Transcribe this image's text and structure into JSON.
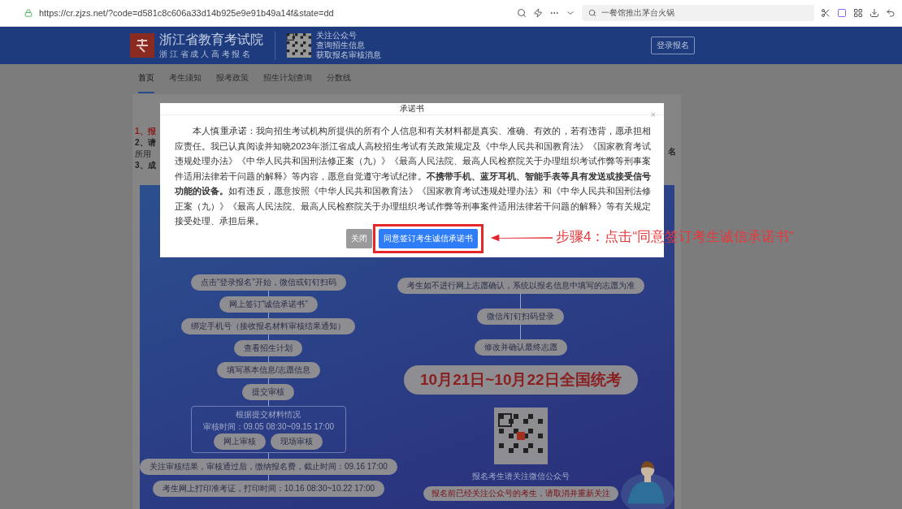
{
  "browser": {
    "url": "https://cr.zjzs.net/?code=d581c8c606a33d14b925e9e91b49a14f&state=dd",
    "search": "一餐馆推出茅台火锅"
  },
  "header": {
    "site_name": "浙江省教育考试院",
    "site_subtitle": "浙 江 省 成 人 高 考 报 名",
    "follow_lines": [
      "关注公众号",
      "查询招生信息",
      "获取报名审核消息"
    ],
    "login_button": "登录报名"
  },
  "nav": [
    {
      "label": "首页",
      "selected": true
    },
    {
      "label": "考生须知",
      "selected": false
    },
    {
      "label": "报考政策",
      "selected": false
    },
    {
      "label": "招生计划查询",
      "selected": false
    },
    {
      "label": "分数线",
      "selected": false
    }
  ],
  "notice_fragments": [
    {
      "text": "1、报",
      "kind": "alert"
    },
    {
      "text": "2、请",
      "kind": "strong"
    },
    {
      "text": "所用",
      "kind": "plain"
    },
    {
      "text": "3、成",
      "kind": "strong"
    }
  ],
  "notice_fragment_right": "名",
  "poster": {
    "left_steps": [
      {
        "text": "点击“登录报名”开始，微信或钉钉扫码",
        "kind": "step"
      },
      {
        "text": "网上签订“诚信承诺书”",
        "kind": "step"
      },
      {
        "text": "绑定手机号（接收报名材料审核结果通知）",
        "kind": "step"
      },
      {
        "text": "查看招生计划",
        "kind": "step"
      },
      {
        "text": "填写基本信息/志愿信息",
        "kind": "step"
      },
      {
        "text": "提交审核",
        "kind": "step"
      },
      {
        "kind": "group",
        "caption": "根据提交材料情况",
        "time": "审核时间：09.05 08:30~09.15 17:00",
        "options": [
          "网上审核",
          "现场审核"
        ]
      },
      {
        "text": "关注审核结果，审核通过后，缴纳报名费，截止时间：09.16 17:00",
        "kind": "step"
      },
      {
        "text": "考生网上打印准考证，打印时间：10.16 08:30~10.22 17:00",
        "kind": "step"
      }
    ],
    "right_steps": [
      {
        "text": "考生如不进行网上志愿确认，系统以报名信息中填写的志愿为准",
        "kind": "step"
      },
      {
        "text": "微信/钉钉扫码登录",
        "kind": "step"
      },
      {
        "text": "修改并确认最终志愿",
        "kind": "step"
      },
      {
        "text": "10月21日~10月22日全国统考",
        "kind": "exam"
      }
    ],
    "qr_caption": "报名考生请关注微信公众号",
    "qr_notice": "报名前已经关注公众号的考生，请取消并重新关注"
  },
  "dialog": {
    "title": "承诺书",
    "close": "×",
    "body": "本人慎重承诺：我向招生考试机构所提供的所有个人信息和有关材料都是真实、准确、有效的，若有违背，愿承担相应责任。我已认真阅读并知晓2023年浙江省成人高校招生考试有关政策规定及《中华人民共和国教育法》《国家教育考试违规处理办法》《中华人民共和国刑法修正案（九）》《最高人民法院、最高人民检察院关于办理组织考试作弊等刑事案件适用法律若干问题的解释》等内容，愿意自觉遵守考试纪律。**不携带手机、蓝牙耳机、智能手表等具有发送或接受信号功能的设备。**如有违反，愿意按照《中华人民共和国教育法》《国家教育考试违规处理办法》和《中华人民共和国刑法修正案（九）》《最高人民法院、最高人民检察院关于办理组织考试作弊等刑事案件适用法律若干问题的解释》等有关规定接受处理、承担后果。",
    "buttons": [
      {
        "label": "关闭",
        "kind": "secondary",
        "highlighted": false
      },
      {
        "label": "同意签订考生诚信承诺书",
        "kind": "primary",
        "highlighted": true
      }
    ]
  },
  "annotation": "步骤4：点击“同意签订考生诚信承诺书”"
}
